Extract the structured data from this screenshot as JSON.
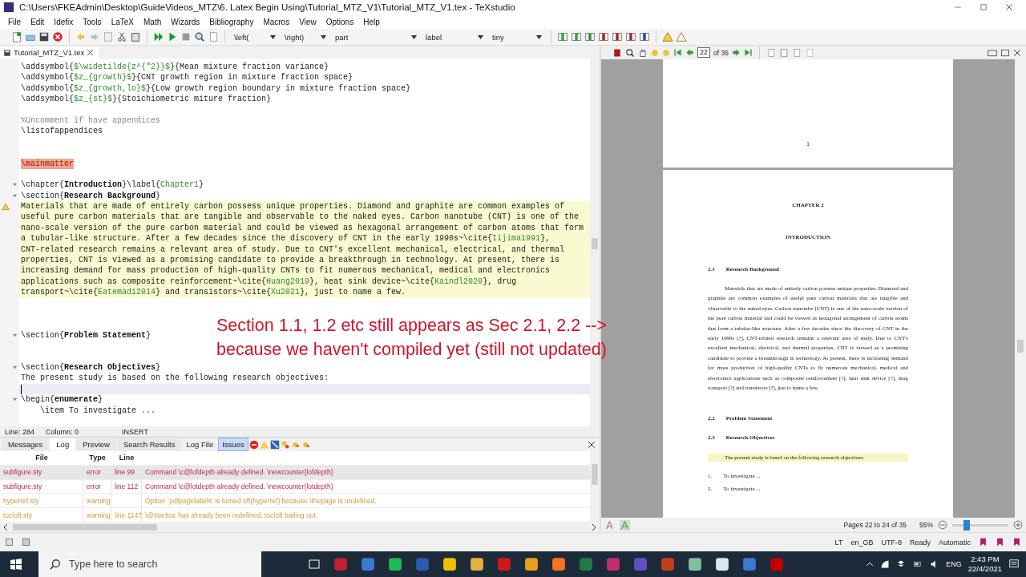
{
  "window": {
    "title": "C:\\Users\\FKEAdmin\\Desktop\\GuideVideos_MTZ\\6. Latex Begin Using\\Tutorial_MTZ_V1\\Tutorial_MTZ_V1.tex - TeXstudio"
  },
  "menu": [
    "File",
    "Edit",
    "Idefix",
    "Tools",
    "LaTeX",
    "Math",
    "Wizards",
    "Bibliography",
    "Macros",
    "View",
    "Options",
    "Help"
  ],
  "toolbar_dropdowns": [
    "\\left(",
    "\\right)",
    "part",
    "label",
    "tiny"
  ],
  "editor_tab": {
    "label": "Tutorial_MTZ_V1.tex"
  },
  "editor_lines": [
    {
      "kind": "code",
      "highlighted": false,
      "segments": [
        {
          "text": "\\addsymbol{",
          "kind": "plain"
        },
        {
          "text": "$\\widetilde{z^{\"2}}$",
          "kind": "arg"
        },
        {
          "text": "}{Mean mixture fraction variance}",
          "kind": "plain"
        }
      ]
    },
    {
      "kind": "code",
      "highlighted": false,
      "segments": [
        {
          "text": "\\addsymbol{",
          "kind": "plain"
        },
        {
          "text": "$z_{growth}$",
          "kind": "arg"
        },
        {
          "text": "}{CNT growth region in mixture fraction space}",
          "kind": "plain"
        }
      ]
    },
    {
      "kind": "code",
      "highlighted": false,
      "segments": [
        {
          "text": "\\addsymbol{",
          "kind": "plain"
        },
        {
          "text": "$z_{growth,lo}$",
          "kind": "arg"
        },
        {
          "text": "}{Low growth region boundary in mixture fraction space}",
          "kind": "plain"
        }
      ]
    },
    {
      "kind": "code",
      "highlighted": false,
      "segments": [
        {
          "text": "\\addsymbol{",
          "kind": "plain"
        },
        {
          "text": "$z_{st}$",
          "kind": "arg"
        },
        {
          "text": "}{Stoichiometric miture fraction}",
          "kind": "plain"
        }
      ]
    },
    {
      "kind": "blank",
      "highlighted": false
    },
    {
      "kind": "code",
      "highlighted": false,
      "segments": [
        {
          "text": "%Uncomment if have appendices",
          "kind": "comment"
        }
      ]
    },
    {
      "kind": "code",
      "highlighted": false,
      "segments": [
        {
          "text": "\\listofappendices",
          "kind": "plain"
        }
      ]
    },
    {
      "kind": "blank",
      "highlighted": false
    },
    {
      "kind": "blank",
      "highlighted": false
    },
    {
      "kind": "code",
      "highlighted": false,
      "segments": [
        {
          "text": "\\mainmatter",
          "kind": "marked"
        }
      ]
    },
    {
      "kind": "blank",
      "highlighted": false
    },
    {
      "kind": "code",
      "highlighted": false,
      "fold": true,
      "segments": [
        {
          "text": "\\chapter{",
          "kind": "plain"
        },
        {
          "text": "Introduction",
          "kind": "bold"
        },
        {
          "text": "}\\label{",
          "kind": "plain"
        },
        {
          "text": "Chapter1",
          "kind": "arg"
        },
        {
          "text": "}",
          "kind": "plain"
        }
      ]
    },
    {
      "kind": "code",
      "highlighted": false,
      "fold": true,
      "segments": [
        {
          "text": "\\section{",
          "kind": "plain"
        },
        {
          "text": "Research Background",
          "kind": "bold"
        },
        {
          "text": "}",
          "kind": "plain"
        }
      ]
    },
    {
      "kind": "code",
      "highlighted": true,
      "warning": true,
      "segments": [
        {
          "text": "Materials that are made of entirely carbon possess unique properties. Diamond and graphite are common examples of",
          "kind": "plain"
        }
      ]
    },
    {
      "kind": "code",
      "highlighted": true,
      "segments": [
        {
          "text": "useful pure carbon materials that are tangible and observable to the naked eyes. Carbon nanotube (CNT) is one of the",
          "kind": "plain"
        }
      ]
    },
    {
      "kind": "code",
      "highlighted": true,
      "segments": [
        {
          "text": "nano-scale version of the pure carbon material and could be viewed as hexagonal arrangement of carbon atoms that form",
          "kind": "plain"
        }
      ]
    },
    {
      "kind": "code",
      "highlighted": true,
      "segments": [
        {
          "text": "a tubular-like structure. After a few decades since the discovery of CNT in the early 1990s~\\cite{",
          "kind": "plain"
        },
        {
          "text": "Iijima1991",
          "kind": "arg"
        },
        {
          "text": "},",
          "kind": "plain"
        }
      ]
    },
    {
      "kind": "code",
      "highlighted": true,
      "segments": [
        {
          "text": "CNT-related research remains a relevant area of study. Due to CNT's excellent mechanical, electrical, and thermal",
          "kind": "plain"
        }
      ]
    },
    {
      "kind": "code",
      "highlighted": true,
      "segments": [
        {
          "text": "properties, CNT is viewed as a promising candidate to provide a breakthrough in technology. At present, there is",
          "kind": "plain"
        }
      ]
    },
    {
      "kind": "code",
      "highlighted": true,
      "segments": [
        {
          "text": "increasing demand for mass production of high-quality CNTs to fit numerous mechanical, medical and electronics",
          "kind": "plain"
        }
      ]
    },
    {
      "kind": "code",
      "highlighted": true,
      "segments": [
        {
          "text": "applications such as composite reinforcement~\\cite{",
          "kind": "plain"
        },
        {
          "text": "Huang2019",
          "kind": "arg"
        },
        {
          "text": "}, heat sink device~\\cite{",
          "kind": "plain"
        },
        {
          "text": "Kaindl2020",
          "kind": "arg"
        },
        {
          "text": "}, drug",
          "kind": "plain"
        }
      ]
    },
    {
      "kind": "code",
      "highlighted": true,
      "segments": [
        {
          "text": "transport~\\cite{",
          "kind": "plain"
        },
        {
          "text": "Eatemadi2014",
          "kind": "arg"
        },
        {
          "text": "} and transistors~\\cite{",
          "kind": "plain"
        },
        {
          "text": "Xu2021",
          "kind": "arg"
        },
        {
          "text": "}, just to name a few.",
          "kind": "plain"
        }
      ]
    },
    {
      "kind": "blank",
      "highlighted": false
    },
    {
      "kind": "blank",
      "highlighted": false
    },
    {
      "kind": "blank",
      "highlighted": false
    },
    {
      "kind": "code",
      "highlighted": false,
      "fold": true,
      "segments": [
        {
          "text": "\\section{",
          "kind": "plain"
        },
        {
          "text": "Problem Statement",
          "kind": "bold"
        },
        {
          "text": "}",
          "kind": "plain"
        }
      ]
    },
    {
      "kind": "blank",
      "highlighted": false
    },
    {
      "kind": "blank",
      "highlighted": false
    },
    {
      "kind": "code",
      "highlighted": false,
      "fold": true,
      "segments": [
        {
          "text": "\\section{",
          "kind": "plain"
        },
        {
          "text": "Research Objectives",
          "kind": "bold"
        },
        {
          "text": "}",
          "kind": "plain"
        }
      ]
    },
    {
      "kind": "code",
      "highlighted": false,
      "segments": [
        {
          "text": "The present study is based on the following research objectives:",
          "kind": "plain"
        }
      ]
    },
    {
      "kind": "cursor",
      "highlighted": false
    },
    {
      "kind": "code",
      "highlighted": false,
      "fold": true,
      "segments": [
        {
          "text": "\\begin{",
          "kind": "plain"
        },
        {
          "text": "enumerate",
          "kind": "bold"
        },
        {
          "text": "}",
          "kind": "plain"
        }
      ]
    },
    {
      "kind": "code",
      "highlighted": false,
      "segments": [
        {
          "text": "    \\item To investigate ...",
          "kind": "plain"
        }
      ]
    }
  ],
  "editor_status": {
    "line": "Line: 284",
    "column": "Column: 0",
    "mode": "INSERT"
  },
  "annotation": [
    "Section 1.1, 1.2 etc still appears as Sec 2.1, 2.2 -->",
    "because we haven't compiled yet (still not updated)"
  ],
  "log_panel": {
    "tabs": [
      {
        "label": "Messages",
        "selected": false
      },
      {
        "label": "Log",
        "selected": true
      },
      {
        "label": "Preview",
        "selected": false
      },
      {
        "label": "Search Results",
        "selected": false
      }
    ],
    "filter_buttons": [
      {
        "label": "Log File",
        "on": false
      },
      {
        "label": "Issues",
        "on": true
      }
    ],
    "columns": [
      "File",
      "Type",
      "Line"
    ],
    "rows": [
      {
        "file": "subfigure.sty",
        "type": "error",
        "line": "line 99",
        "message": "Command \\c@lofdepth already defined. \\newcounter{lofdepth}",
        "kind": "error",
        "selected": true
      },
      {
        "file": "subfigure.sty",
        "type": "error",
        "line": "line 112",
        "message": "Command \\c@lotdepth already defined. \\newcounter{lotdepth}",
        "kind": "error",
        "selected": false
      },
      {
        "file": "hyperref.sty",
        "type": "warning",
        "message": "Option `pdfpagelabels' is turned off(hyperref) because \\thepage is undefined.",
        "kind": "warning",
        "selected": false
      },
      {
        "file": "tocloft.sty",
        "type": "warning",
        "line": "line 1147",
        "message": "\\@starttoc has already been redefined; tocloft bailing out.",
        "kind": "warning",
        "selected": false
      }
    ]
  },
  "pdf_viewer": {
    "page_input": "22",
    "page_total": "of 35",
    "page_number": "1",
    "chapter": "CHAPTER 2",
    "chapter_title": "INTRODUCTION",
    "sections": [
      {
        "number": "2.1",
        "title": "Research Background"
      }
    ],
    "paragraph": "Materials that are made of entirely carbon possess unique properties. Diamond and graphite are common examples of useful pure carbon materials that are tangible and observable to the naked eyes. Carbon nanotube (CNT) is one of the nano-scale version of the pure carbon material and could be viewed as hexagonal arrangement of carbon atoms that form a tubular-like structure. After a few decades since the discovery of CNT in the early 1990s [?], CNT-related research remains a relevant area of study. Due to CNT's excellent mechanical, electrical, and thermal properties, CNT is viewed as a promising candidate to provide a breakthrough in technology. At present, there is increasing demand for mass production of high-quality CNTs to fit numerous mechanical, medical and electronics applications such as composite reinforcement [?], heat sink device [?], drug transport [?] and transistors [?], just to name a few.",
    "later_sections": [
      {
        "number": "2.2",
        "title": "Problem Statement"
      },
      {
        "number": "2.3",
        "title": "Research Objectives"
      }
    ],
    "highlighted_sentence": "The present study is based on the following research objectives:",
    "list_items": [
      {
        "number": "1.",
        "text": "To investigate ..."
      },
      {
        "number": "2.",
        "text": "To investigate ..."
      }
    ],
    "status": "Pages 22 to 24 of 35",
    "zoom": "55%",
    "zoom_slider": {
      "level": 0.25
    }
  },
  "status_bar": [
    "LT",
    "en_GB",
    "UTF-8",
    "Ready",
    "Automatic"
  ],
  "taskbar": {
    "search_placeholder": "Type here to search",
    "language": "ENG",
    "time": "2:43 PM",
    "date": "22/4/2021"
  }
}
